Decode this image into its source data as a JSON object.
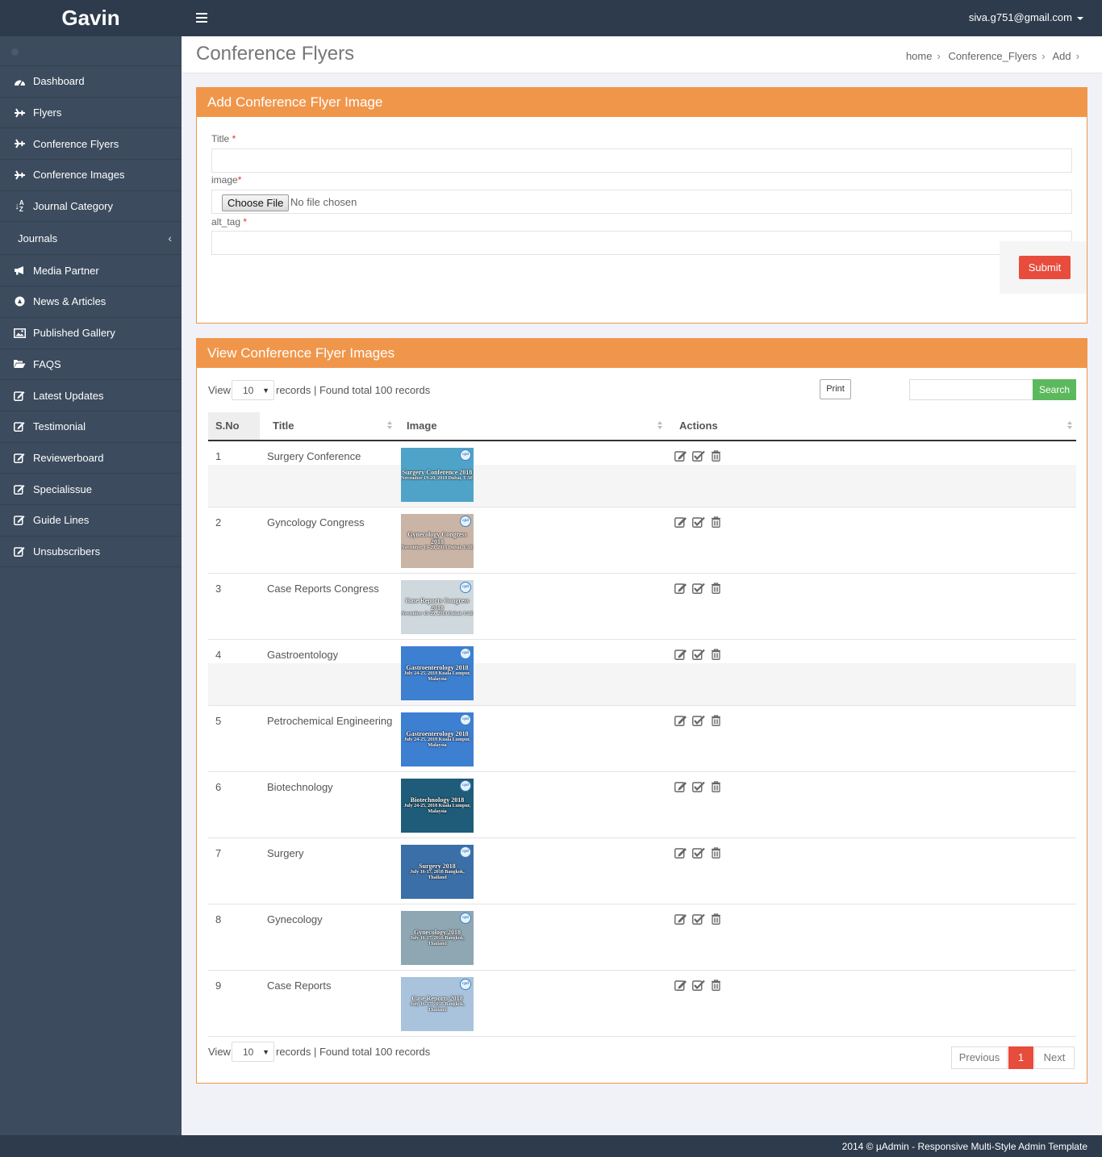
{
  "brand": "Gavin",
  "user": {
    "email": "siva.g751@gmail.com"
  },
  "sidebar": {
    "items": [
      {
        "label": "Dashboard",
        "icon": "dashboard-icon"
      },
      {
        "label": "Flyers",
        "icon": "plane-icon"
      },
      {
        "label": "Conference Flyers",
        "icon": "plane-icon"
      },
      {
        "label": "Conference Images",
        "icon": "plane-icon"
      },
      {
        "label": "Journal Category",
        "icon": "sort-alpha-icon"
      },
      {
        "label": "Journals",
        "icon": ""
      },
      {
        "label": "Media Partner",
        "icon": "bullhorn-icon"
      },
      {
        "label": "News & Articles",
        "icon": "compass-icon"
      },
      {
        "label": "Published Gallery",
        "icon": "picture-icon"
      },
      {
        "label": "FAQS",
        "icon": "folder-open-icon"
      },
      {
        "label": "Latest Updates",
        "icon": "edit-icon"
      },
      {
        "label": "Testimonial",
        "icon": "edit-icon"
      },
      {
        "label": "Reviewerboard",
        "icon": "edit-icon"
      },
      {
        "label": "Specialissue",
        "icon": "edit-icon"
      },
      {
        "label": "Guide Lines",
        "icon": "edit-icon"
      },
      {
        "label": "Unsubscribers",
        "icon": "edit-icon"
      }
    ]
  },
  "page": {
    "title": "Conference Flyers",
    "breadcrumb": [
      "home",
      "Conference_Flyers",
      "Add"
    ]
  },
  "form": {
    "heading": "Add Conference Flyer Image",
    "title_label": "Title",
    "image_label": "image",
    "alt_label": "alt_tag",
    "required_mark": "*",
    "title_value": "",
    "alt_value": "",
    "choose_file": "Choose File",
    "no_file": "No file chosen",
    "submit": "Submit"
  },
  "list": {
    "heading": "View Conference Flyer Images",
    "view_label": "View",
    "page_size": "10",
    "records_text": "records | Found total 100 records",
    "print": "Print",
    "search_value": "",
    "search_button": "Search",
    "columns": [
      "S.No",
      "Title",
      "Image",
      "Actions"
    ],
    "rows": [
      {
        "no": "1",
        "title": "Surgery Conference",
        "img_line1": "Surgery Conference 2018",
        "img_line2": "November 19-20, 2018 Dubai, UAE",
        "img_line3": "",
        "img_bg": "#4fa3c8"
      },
      {
        "no": "2",
        "title": "Gyncology Congress",
        "img_line1": "Gynecology Congress 2018",
        "img_line2": "November 19-20, 2018 Dubai, UAE",
        "img_line3": "",
        "img_bg": "#c9b4a6"
      },
      {
        "no": "3",
        "title": "Case Reports Congress",
        "img_line1": "Case Reports Congress 2018",
        "img_line2": "November 19-20, 2018 Dubai, UAE",
        "img_line3": "",
        "img_bg": "#cfd8dd"
      },
      {
        "no": "4",
        "title": "Gastroentology",
        "img_line1": "Gastroenterology 2018",
        "img_line2": "July 24-25, 2018 Kuala Lumpur,",
        "img_line3": "Malaysia",
        "img_bg": "#3d7fd1"
      },
      {
        "no": "5",
        "title": "Petrochemical Engineering",
        "img_line1": "Gastroenterology 2018",
        "img_line2": "July 24-25, 2018 Kuala Lumpur,",
        "img_line3": "Malaysia",
        "img_bg": "#3d7fd1"
      },
      {
        "no": "6",
        "title": "Biotechnology",
        "img_line1": "Biotechnology 2018",
        "img_line2": "July 24-25, 2018 Kuala Lumpur,",
        "img_line3": "Malaysia",
        "img_bg": "#1f5c7a"
      },
      {
        "no": "7",
        "title": "Surgery",
        "img_line1": "Surgery 2018",
        "img_line2": "July 16-17, 2018 Bangkok, Thailand",
        "img_line3": "",
        "img_bg": "#3b6fa8"
      },
      {
        "no": "8",
        "title": "Gynecology",
        "img_line1": "Gynecology 2018",
        "img_line2": "July 16-17, 2018 Bangkok, Thailand",
        "img_line3": "",
        "img_bg": "#8fa7b3"
      },
      {
        "no": "9",
        "title": "Case Reports",
        "img_line1": "Case Reports 2018",
        "img_line2": "July 16-17, 2018 Bangkok, Thailand",
        "img_line3": "",
        "img_bg": "#a9c3dc"
      }
    ],
    "pager": {
      "previous": "Previous",
      "current": "1",
      "next": "Next"
    }
  },
  "footer": "2014 © µAdmin - Responsive Multi-Style Admin Template",
  "colors": {
    "accent": "#f0964b",
    "danger": "#e74c3c",
    "success": "#5cb85c",
    "sidebar": "#3c4b5e",
    "topbar": "#2e3b4c"
  }
}
